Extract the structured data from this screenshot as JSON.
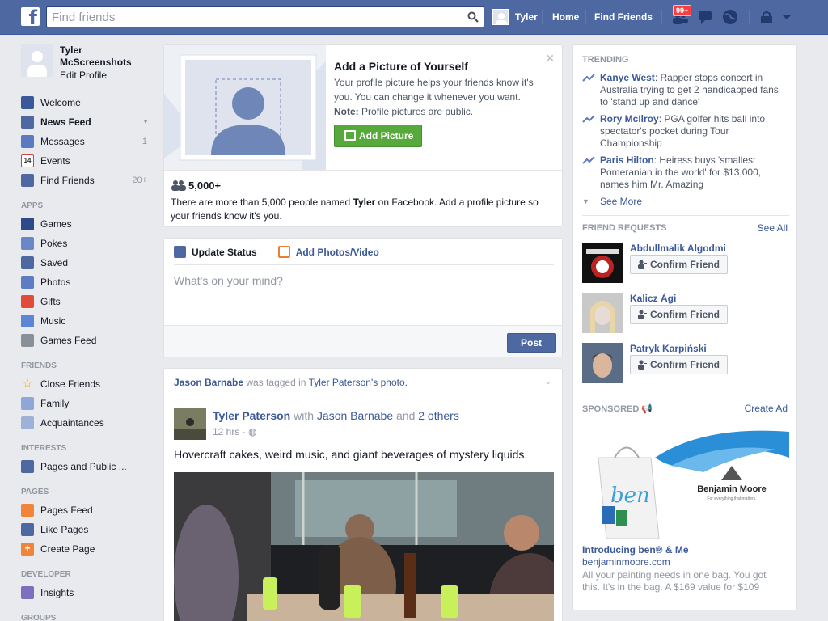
{
  "topbar": {
    "search_placeholder": "Find friends",
    "user_name": "Tyler",
    "home_label": "Home",
    "find_friends_label": "Find Friends",
    "friend_requests_badge": "99+"
  },
  "sidebar": {
    "profile_name": "Tyler McScreenshots",
    "edit_profile": "Edit Profile",
    "main_items": [
      {
        "label": "Welcome",
        "count": "",
        "icon": "facebook-icon"
      },
      {
        "label": "News Feed",
        "count": "",
        "icon": "news-feed-icon"
      },
      {
        "label": "Messages",
        "count": "1",
        "icon": "messages-icon"
      },
      {
        "label": "Events",
        "count": "",
        "icon": "calendar-icon",
        "day": "14"
      },
      {
        "label": "Find Friends",
        "count": "20+",
        "icon": "find-friends-icon"
      }
    ],
    "apps_header": "APPS",
    "apps": [
      "Games",
      "Pokes",
      "Saved",
      "Photos",
      "Gifts",
      "Music",
      "Games Feed"
    ],
    "friends_header": "FRIENDS",
    "friends": [
      "Close Friends",
      "Family",
      "Acquaintances"
    ],
    "interests_header": "INTERESTS",
    "interests": [
      "Pages and Public ..."
    ],
    "pages_header": "PAGES",
    "pages": [
      "Pages Feed",
      "Like Pages",
      "Create Page"
    ],
    "developer_header": "DEVELOPER",
    "developer": [
      "Insights"
    ],
    "groups_header": "GROUPS"
  },
  "add_picture": {
    "title": "Add a Picture of Yourself",
    "description": "Your profile picture helps your friends know it's you. You can change it whenever you want.",
    "note_label": "Note:",
    "note_text": "Profile pictures are public.",
    "button": "Add Picture",
    "close": "×",
    "count": "5,000+",
    "info_pre": "There are more than 5,000 people named",
    "info_name": "Tyler",
    "info_post": "on Facebook. Add a profile picture so your friends know it's you."
  },
  "composer": {
    "tab_status": "Update Status",
    "tab_photos": "Add Photos/Video",
    "placeholder": "What's on your mind?",
    "post_button": "Post"
  },
  "story": {
    "tag_actor": "Jason Barnabe",
    "tag_mid": "was tagged in",
    "tag_owner": "Tyler Paterson's",
    "tag_obj": "photo.",
    "author": "Tyler Paterson",
    "with_word": "with",
    "with_friend": "Jason Barnabe",
    "and_word": "and",
    "others": "2 others",
    "time": "12 hrs",
    "message": "Hovercraft cakes, weird music, and giant beverages of mystery liquids."
  },
  "right": {
    "trending_header": "TRENDING",
    "trending": [
      {
        "name": "Kanye West",
        "text": ": Rapper stops concert in Australia trying to get 2 handicapped fans to 'stand up and dance'"
      },
      {
        "name": "Rory McIlroy",
        "text": ": PGA golfer hits ball into spectator's pocket during Tour Championship"
      },
      {
        "name": "Paris Hilton",
        "text": ": Heiress buys 'smallest Pomeranian in the world' for $13,000, names him Mr. Amazing"
      }
    ],
    "see_more": "See More",
    "friend_requests_header": "FRIEND REQUESTS",
    "see_all": "See All",
    "requests": [
      {
        "name": "Abdullmalik Algodmi",
        "button": "Confirm Friend"
      },
      {
        "name": "Kalicz Ági",
        "button": "Confirm Friend"
      },
      {
        "name": "Patryk Karpiński",
        "button": "Confirm Friend"
      }
    ],
    "sponsored_header": "SPONSORED",
    "create_ad": "Create Ad",
    "ad_brand": "Benjamin Moore",
    "ad_tagline": "For everything that matters.",
    "ad_bag_text": "ben",
    "ad_title": "Introducing ben® & Me",
    "ad_url": "benjaminmoore.com",
    "ad_desc": "All your painting needs in one bag. You got this. It's in the bag. A $169 value for $109"
  }
}
